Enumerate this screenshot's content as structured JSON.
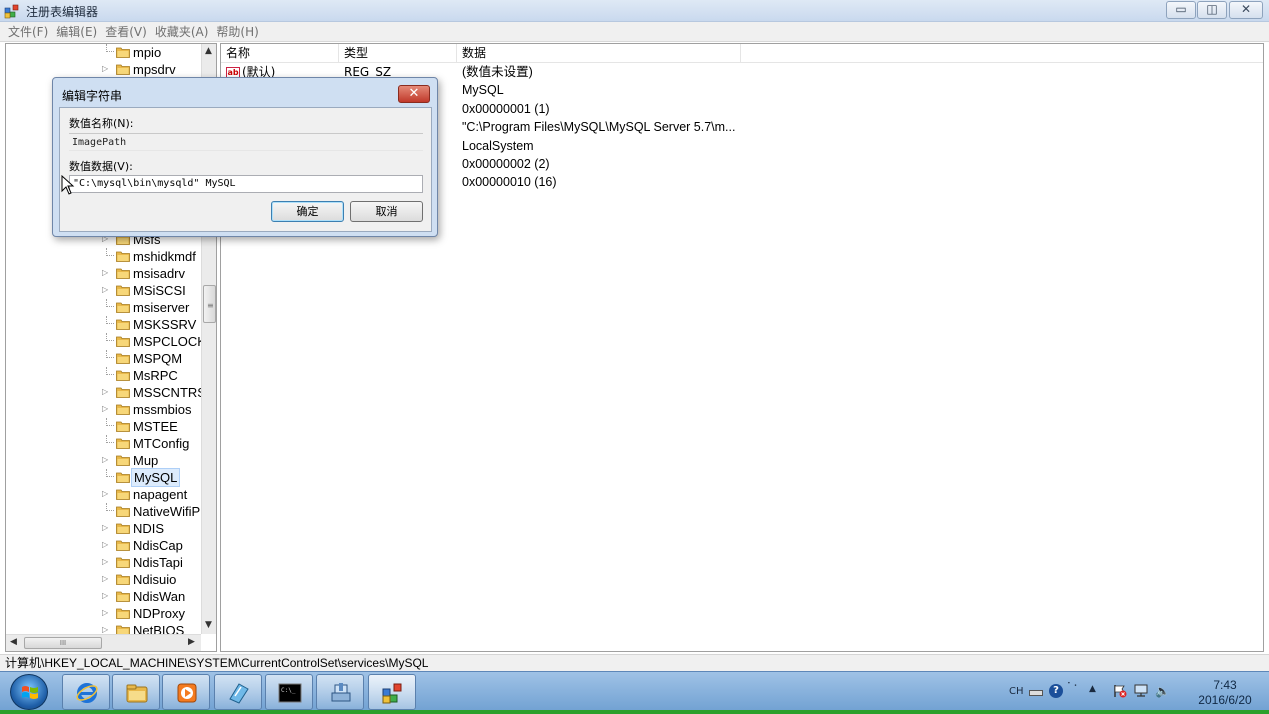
{
  "window": {
    "title": "注册表编辑器",
    "minimize_glyph": "▭",
    "maximize_glyph": "◫",
    "close_glyph": "✕"
  },
  "menu": [
    "文件(F)",
    "编辑(E)",
    "查看(V)",
    "收藏夹(A)",
    "帮助(H)"
  ],
  "tree": {
    "top_items": [
      "mpio",
      "mpsdrv"
    ],
    "items": [
      "Msfs",
      "mshidkmdf",
      "msisadrv",
      "MSiSCSI",
      "msiserver",
      "MSKSSRV",
      "MSPCLOCK",
      "MSPQM",
      "MsRPC",
      "MSSCNTRS",
      "mssmbios",
      "MSTEE",
      "MTConfig",
      "Mup",
      "MySQL",
      "napagent",
      "NativeWifiP",
      "NDIS",
      "NdisCap",
      "NdisTapi",
      "Ndisuio",
      "NdisWan",
      "NDProxy",
      "NetBIOS"
    ],
    "selected": "MySQL",
    "hscroll_grip": "III"
  },
  "list": {
    "headers": {
      "name": "名称",
      "type": "类型",
      "data": "数据"
    },
    "rows": [
      {
        "name": "(默认)",
        "type": "REG_SZ",
        "data": "(数值未设置)"
      },
      {
        "name": "",
        "type": "",
        "data": "MySQL"
      },
      {
        "name": "",
        "type": "",
        "data": "0x00000001 (1)"
      },
      {
        "name": "",
        "type": "",
        "data": "\"C:\\Program Files\\MySQL\\MySQL Server 5.7\\m..."
      },
      {
        "name": "",
        "type": "",
        "data": "LocalSystem"
      },
      {
        "name": "",
        "type": "",
        "data": "0x00000002 (2)"
      },
      {
        "name": "",
        "type": "",
        "data": "0x00000010 (16)"
      }
    ],
    "ab_icon_text": "ab"
  },
  "statusbar": {
    "path": "计算机\\HKEY_LOCAL_MACHINE\\SYSTEM\\CurrentControlSet\\services\\MySQL"
  },
  "dialog": {
    "title": "编辑字符串",
    "name_label": "数值名称(N):",
    "name_value": "ImagePath",
    "data_label": "数值数据(V):",
    "data_value": "\"C:\\mysql\\bin\\mysqld\" MySQL",
    "ok_label": "确定",
    "cancel_label": "取消",
    "close_glyph": "✕"
  },
  "taskbar": {
    "tray": {
      "lang": "CH",
      "help_glyph": "?",
      "time": "7:43",
      "date": "2016/6/20"
    }
  },
  "colors": {
    "accent_green": "#2ca02c",
    "taskbar_blue": "#6e9fd1",
    "selection": "#dcebfc",
    "folder": "#e8b84a"
  }
}
